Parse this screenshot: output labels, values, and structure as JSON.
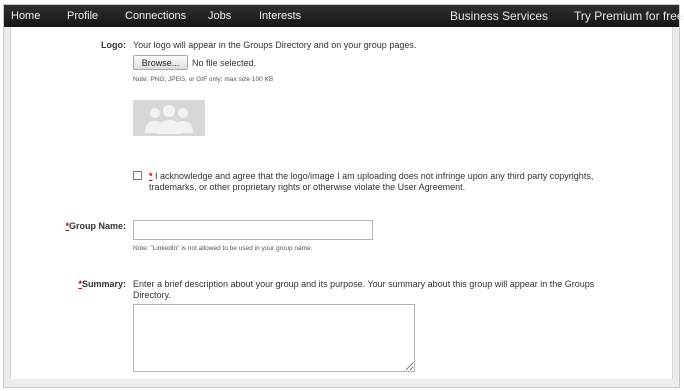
{
  "nav": {
    "home": "Home",
    "profile": "Profile",
    "connections": "Connections",
    "jobs": "Jobs",
    "interests": "Interests",
    "business_services": "Business Services",
    "try_premium": "Try Premium for free"
  },
  "logo": {
    "label": "Logo:",
    "description": "Your logo will appear in the Groups Directory and on your group pages.",
    "browse_label": "Browse...",
    "file_status": "No file selected.",
    "note": "Note: PNG, JPEG, or GIF only; max size 100 KB",
    "placeholder_icon": "group-silhouette-icon"
  },
  "acknowledge": {
    "required_mark": "*",
    "text": "I acknowledge and agree that the logo/image I am uploading does not infringe upon any third party copyrights, trademarks, or other proprietary rights or otherwise violate the User Agreement.",
    "checked": false
  },
  "group_name": {
    "required_mark": "*",
    "label": "Group Name:",
    "value": "",
    "note": "Note: \"LinkedIn\" is not allowed to be used in your group name."
  },
  "summary": {
    "required_mark": "*",
    "label": "Summary:",
    "description": "Enter a brief description about your group and its purpose. Your summary about this group will appear in the Groups Directory.",
    "value": ""
  }
}
